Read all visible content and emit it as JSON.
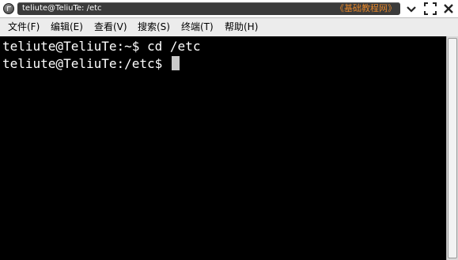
{
  "window": {
    "title": "teliute@TeliuTe: /etc",
    "watermark": "《基础教程网》",
    "controls": [
      "minimize-icon",
      "maximize-icon",
      "close-icon"
    ]
  },
  "menu": {
    "items": [
      {
        "label": "文件(F)"
      },
      {
        "label": "编辑(E)"
      },
      {
        "label": "查看(V)"
      },
      {
        "label": "搜索(S)"
      },
      {
        "label": "终端(T)"
      },
      {
        "label": "帮助(H)"
      }
    ]
  },
  "terminal": {
    "lines": [
      "teliute@TeliuTe:~$ cd /etc",
      "teliute@TeliuTe:/etc$ "
    ],
    "background": "#000000",
    "foreground": "#ffffff"
  }
}
